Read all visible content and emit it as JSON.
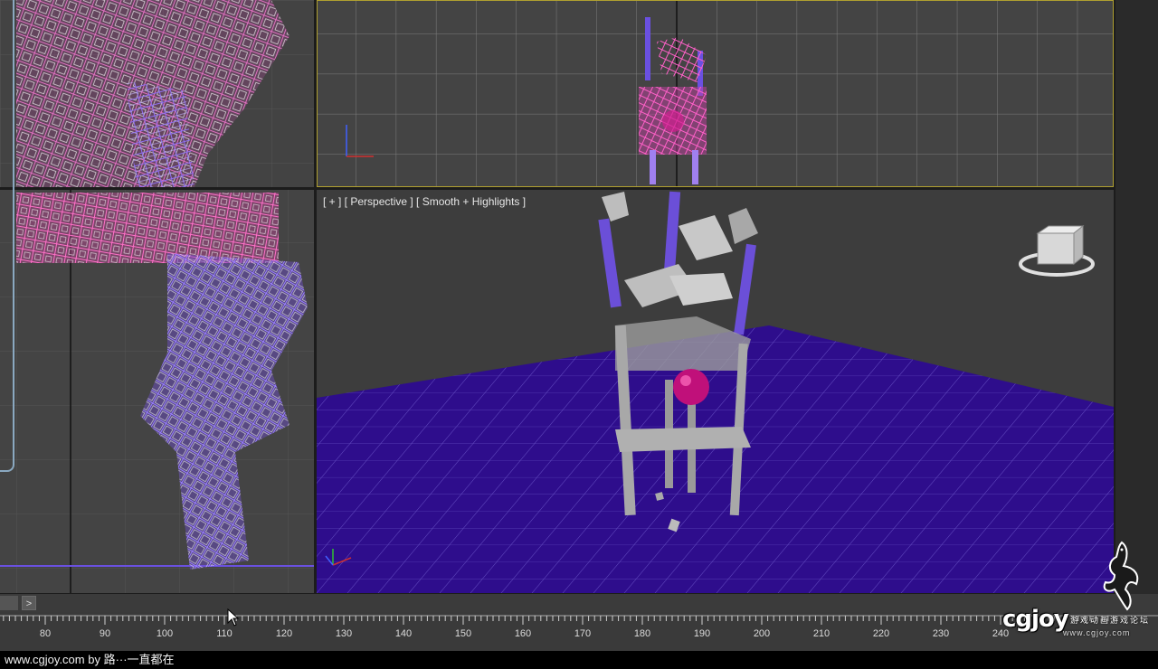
{
  "viewports": {
    "top": {
      "name": "top-viewport"
    },
    "perspective": {
      "label": "[ + ] [ Perspective ] [ Smooth + Highlights ]"
    }
  },
  "timebar": {
    "next_label": ">"
  },
  "timeline": {
    "ticks": [
      "80",
      "90",
      "100",
      "110",
      "120",
      "130",
      "140",
      "150",
      "160",
      "170",
      "180",
      "190",
      "200",
      "210",
      "220",
      "230",
      "240"
    ]
  },
  "status": {
    "credit_text": "www.cgjoy.com by 路···一直都在"
  },
  "watermark": {
    "logo": "cgjoy",
    "subtitle": "游戏动画游戏论坛",
    "url": "www.cgjoy.com"
  },
  "icons": {
    "viewcube": "viewcube-icon",
    "axis_gizmo": "axis-gizmo-icon",
    "cursor": "mouse-cursor-icon",
    "mascot": "gecko-mascot-icon"
  },
  "colors": {
    "viewport_bg": "#444444",
    "active_border": "#b0a030",
    "ground_plane": "#2e0d8c",
    "wire_pink": "#d060b0",
    "wire_purple": "#8060e0",
    "chair_gray": "#a8a8a8",
    "ball_magenta": "#c0107a"
  }
}
